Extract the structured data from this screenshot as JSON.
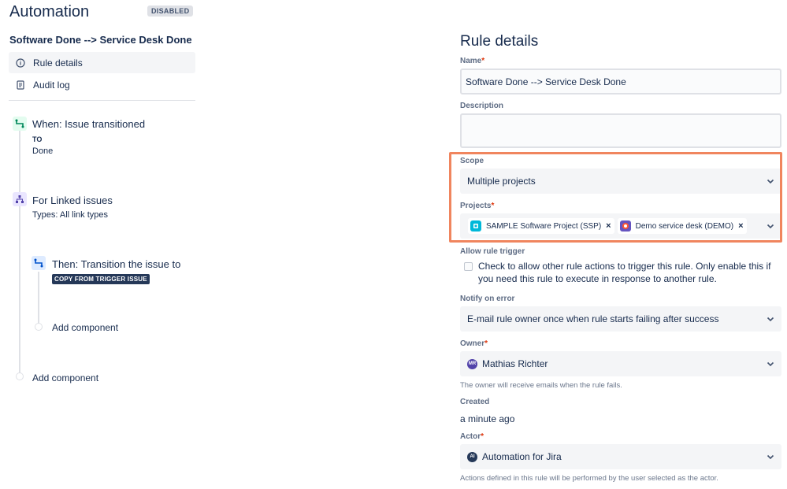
{
  "app": {
    "title": "Automation",
    "status": "DISABLED"
  },
  "rule": {
    "name": "Software Done --> Service Desk Done"
  },
  "nav": {
    "items": [
      {
        "label": "Rule details",
        "icon": "info-icon",
        "active": true
      },
      {
        "label": "Audit log",
        "icon": "document-icon",
        "active": false
      }
    ]
  },
  "flow": {
    "trigger": {
      "title": "When: Issue transitioned",
      "to_label": "TO",
      "to_value": "Done"
    },
    "branch": {
      "title": "For Linked issues",
      "subtitle": "Types: All link types"
    },
    "action": {
      "title": "Then: Transition the issue to",
      "badge": "COPY FROM TRIGGER ISSUE"
    },
    "add_inner": "Add component",
    "add_outer": "Add component"
  },
  "details": {
    "title": "Rule details",
    "name": {
      "label": "Name",
      "required": "*",
      "value": "Software Done --> Service Desk Done"
    },
    "description": {
      "label": "Description",
      "value": ""
    },
    "scope": {
      "label": "Scope",
      "value": "Multiple projects"
    },
    "projects": {
      "label": "Projects",
      "required": "*",
      "tags": [
        {
          "label": "SAMPLE Software Project (SSP)",
          "icon": "software-project-icon",
          "color": "#00b8d9"
        },
        {
          "label": "Demo service desk (DEMO)",
          "icon": "service-desk-icon",
          "color": "#6554c0"
        }
      ]
    },
    "allow_trigger": {
      "label": "Allow rule trigger",
      "text": "Check to allow other rule actions to trigger this rule. Only enable this if you need this rule to execute in response to another rule."
    },
    "notify": {
      "label": "Notify on error",
      "value": "E-mail rule owner once when rule starts failing after success"
    },
    "owner": {
      "label": "Owner",
      "required": "*",
      "avatar_initials": "MR",
      "value": "Mathias Richter",
      "help": "The owner will receive emails when the rule fails."
    },
    "created": {
      "label": "Created",
      "value": "a minute ago"
    },
    "actor": {
      "label": "Actor",
      "required": "*",
      "avatar_initials": "AI",
      "value": "Automation for Jira",
      "help": "Actions defined in this rule will be performed by the user selected as the actor."
    }
  },
  "colors": {
    "highlight": "#f0855e",
    "trigger": "#00875a",
    "branch": "#5243aa",
    "action": "#0052cc",
    "owner_avatar": "#5243aa",
    "actor_avatar": "#253858"
  }
}
